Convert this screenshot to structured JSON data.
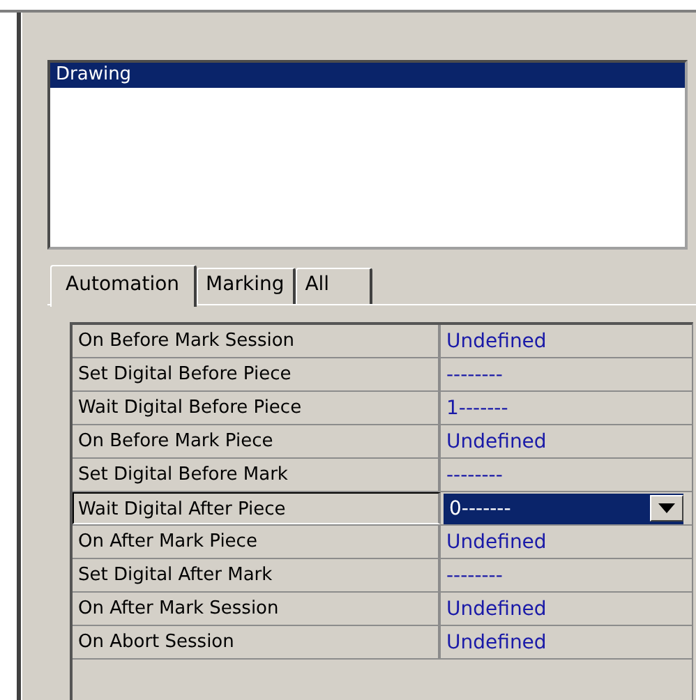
{
  "list": {
    "items": [
      {
        "label": "Drawing",
        "selected": true
      }
    ]
  },
  "tabs": [
    {
      "label": "Automation",
      "selected": true
    },
    {
      "label": "Marking",
      "selected": false
    },
    {
      "label": "All",
      "selected": false
    }
  ],
  "properties": [
    {
      "name": "On Before Mark Session",
      "value": "Undefined",
      "selected": false
    },
    {
      "name": "Set Digital Before Piece",
      "value": "--------",
      "selected": false
    },
    {
      "name": "Wait Digital Before Piece",
      "value": "1-------",
      "selected": false
    },
    {
      "name": "On Before Mark Piece",
      "value": "Undefined",
      "selected": false
    },
    {
      "name": "Set Digital Before Mark",
      "value": "--------",
      "selected": false
    },
    {
      "name": "Wait Digital After Piece",
      "value": "0-------",
      "selected": true
    },
    {
      "name": "On After Mark Piece",
      "value": "Undefined",
      "selected": false
    },
    {
      "name": "Set Digital After Mark",
      "value": "--------",
      "selected": false
    },
    {
      "name": "On After Mark Session",
      "value": "Undefined",
      "selected": false
    },
    {
      "name": "On Abort Session",
      "value": "Undefined",
      "selected": false
    }
  ]
}
